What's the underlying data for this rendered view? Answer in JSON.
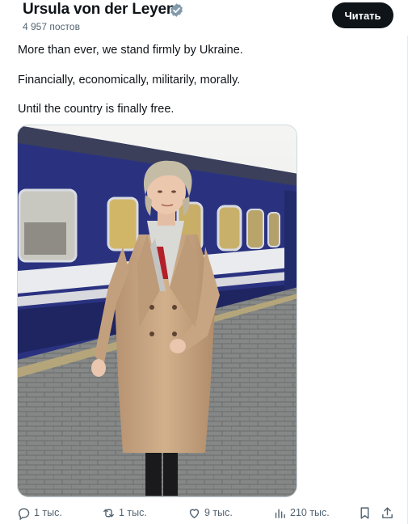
{
  "header": {
    "name": "Ursula von der Leyen",
    "posts_count": "4 957 постов",
    "follow_label": "Читать"
  },
  "tweet": {
    "line1": "More than ever, we stand firmly by Ukraine.",
    "line2": "Financially, economically, militarily, morally.",
    "line3": "Until the country is finally free."
  },
  "actions": {
    "reply_count": "1 тыс.",
    "repost_count": "1 тыс.",
    "like_count": "9 тыс.",
    "views_count": "210 тыс."
  },
  "icons": [
    "verified-icon",
    "reply-icon",
    "repost-icon",
    "like-icon",
    "views-icon",
    "bookmark-icon",
    "share-icon"
  ],
  "colors": {
    "verified": "#829aab",
    "button_bg": "#0f1419",
    "secondary_text": "#536471",
    "train_blue": "#27307a",
    "coat": "#c9a783"
  }
}
